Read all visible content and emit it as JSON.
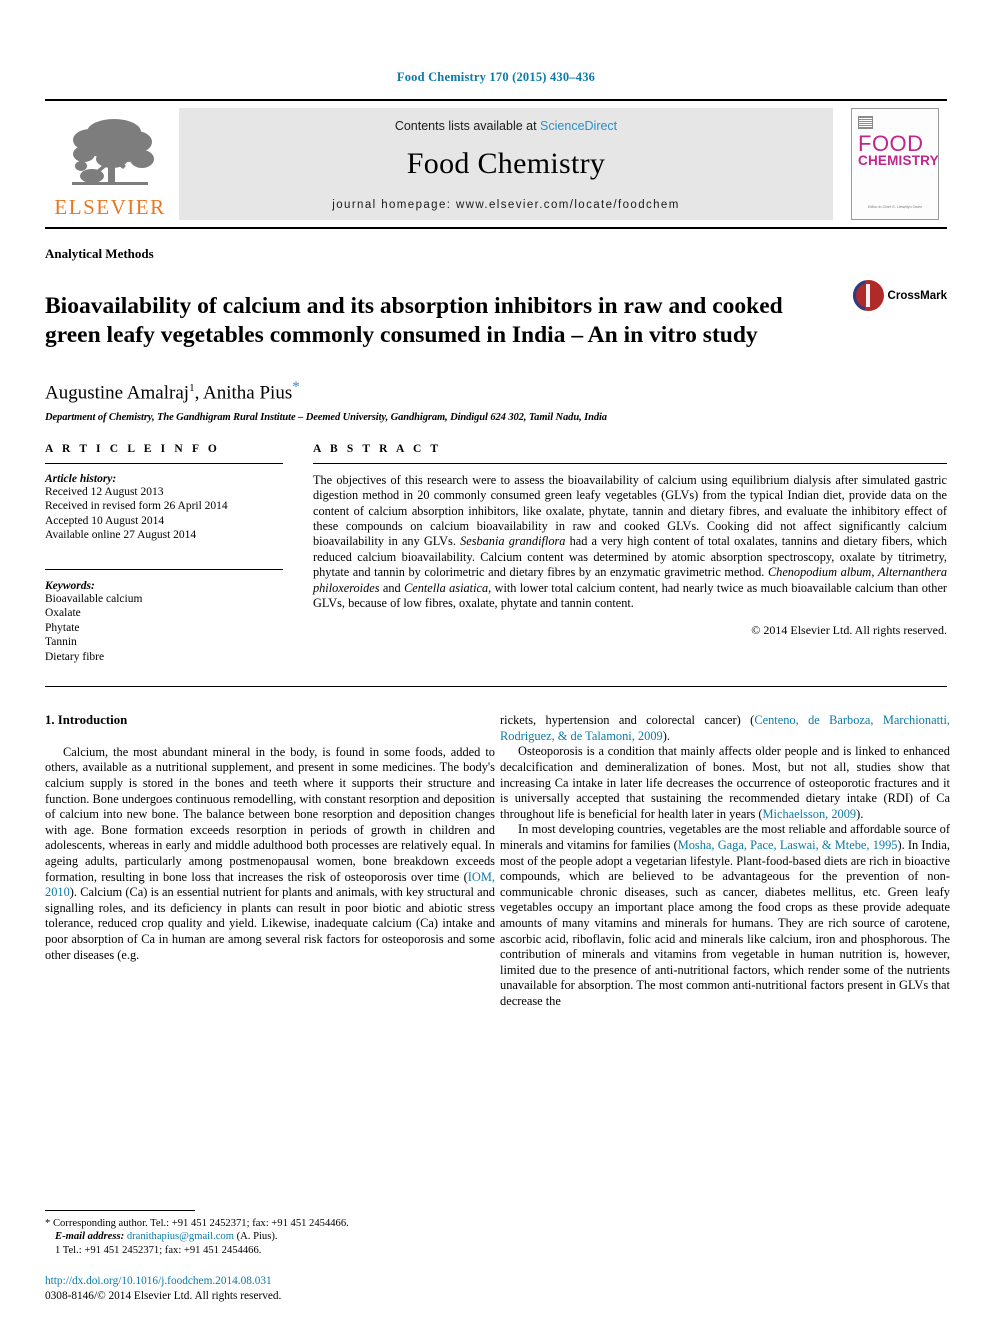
{
  "running_head": "Food Chemistry 170 (2015) 430–436",
  "masthead": {
    "publisher_name": "ELSEVIER",
    "contents_prefix": "Contents lists available at ",
    "contents_link": "ScienceDirect",
    "journal_name": "Food Chemistry",
    "homepage": "journal homepage: www.elsevier.com/locate/foodchem",
    "cover": {
      "line1": "FOOD",
      "line2": "CHEMISTRY",
      "footer": "Editor-in-Chief\nG. Llewellyn Owen"
    }
  },
  "article": {
    "section_kind": "Analytical Methods",
    "title": "Bioavailability of calcium and its absorption inhibitors in raw and cooked green leafy vegetables commonly consumed in India – An in vitro study",
    "crossmark_label": "CrossMark",
    "authors_1": "Augustine Amalraj",
    "authors_1_sup": "1",
    "authors_2": "Anitha Pius",
    "authors_2_sup": "*",
    "affiliation": "Department of Chemistry, The Gandhigram Rural Institute – Deemed University, Gandhigram, Dindigul 624 302, Tamil Nadu, India"
  },
  "article_info": {
    "heading": "A R T I C L E    I N F O",
    "history_label": "Article history:",
    "history": [
      "Received 12 August 2013",
      "Received in revised form 26 April 2014",
      "Accepted 10 August 2014",
      "Available online 27 August 2014"
    ],
    "keywords_label": "Keywords:",
    "keywords": [
      "Bioavailable calcium",
      "Oxalate",
      "Phytate",
      "Tannin",
      "Dietary fibre"
    ]
  },
  "abstract": {
    "heading": "A B S T R A C T",
    "p1_a": "The objectives of this research were to assess the bioavailability of calcium using equilibrium dialysis after simulated gastric digestion method in 20 commonly consumed green leafy vegetables (GLVs) from the typical Indian diet, provide data on the content of calcium absorption inhibitors, like oxalate, phytate, tannin and dietary fibres, and evaluate the inhibitory effect of these compounds on calcium bioavailability in raw and cooked GLVs. Cooking did not affect significantly calcium bioavailability in any GLVs. ",
    "sp1": "Sesbania grandiflora",
    "p1_b": " had a very high content of total oxalates, tannins and dietary fibers, which reduced calcium bioavailability. Calcium content was determined by atomic absorption spectroscopy, oxalate by titrimetry, phytate and tannin by colorimetric and dietary fibres by an enzymatic gravimetric method. ",
    "sp2": "Chenopodium album",
    "p1_c": ", ",
    "sp3": "Alternanthera philoxeroides",
    "p1_d": " and ",
    "sp4": "Centella asiatica",
    "p1_e": ", with lower total calcium content, had nearly twice as much bioavailable calcium than other GLVs, because of low fibres, oxalate, phytate and tannin content.",
    "copyright": "© 2014 Elsevier Ltd. All rights reserved."
  },
  "body": {
    "intro_heading": "1. Introduction",
    "left": {
      "p1_a": "Calcium, the most abundant mineral in the body, is found in some foods, added to others, available as a nutritional supplement, and present in some medicines. The body's calcium supply is stored in the bones and teeth where it supports their structure and function. Bone undergoes continuous remodelling, with constant resorption and deposition of calcium into new bone. The balance between bone resorption and deposition changes with age. Bone formation exceeds resorption in periods of growth in children and adolescents, whereas in early and middle adulthood both processes are relatively equal. In ageing adults, particularly among postmenopausal women, bone breakdown exceeds formation, resulting in bone loss that increases the risk of osteoporosis over time (",
      "cite1": "IOM, 2010",
      "p1_b": "). Calcium (Ca) is an essential nutrient for plants and animals, with key structural and signalling roles, and its deficiency in plants can result in poor biotic and abiotic stress tolerance, reduced crop quality and yield. Likewise, inadequate calcium (Ca) intake and poor absorption of Ca in human are among several risk factors for osteoporosis and some other diseases (e.g."
    },
    "right": {
      "p1_a": "rickets, hypertension and colorectal cancer) (",
      "cite1": "Centeno, de Barboza, Marchionatti, Rodriguez, & de Talamoni, 2009",
      "p1_b": ").",
      "p2_a": "Osteoporosis is a condition that mainly affects older people and is linked to enhanced decalcification and demineralization of bones. Most, but not all, studies show that increasing Ca intake in later life decreases the occurrence of osteoporotic fractures and it is universally accepted that sustaining the recommended dietary intake (RDI) of Ca throughout life is beneficial for health later in years (",
      "cite2": "Michaelsson, 2009",
      "p2_b": ").",
      "p3_a": "In most developing countries, vegetables are the most reliable and affordable source of minerals and vitamins for families (",
      "cite3": "Mosha, Gaga, Pace, Laswai, & Mtebe, 1995",
      "p3_b": "). In India, most of the people adopt a vegetarian lifestyle. Plant-food-based diets are rich in bioactive compounds, which are believed to be advantageous for the prevention of non-communicable chronic diseases, such as cancer, diabetes mellitus, etc. Green leafy vegetables occupy an important place among the food crops as these provide adequate amounts of many vitamins and minerals for humans. They are rich source of carotene, ascorbic acid, riboflavin, folic acid and minerals like calcium, iron and phosphorous. The contribution of minerals and vitamins from vegetable in human nutrition is, however, limited due to the presence of anti-nutritional factors, which render some of the nutrients unavailable for absorption. The most common anti-nutritional factors present in GLVs that decrease the"
    }
  },
  "footnotes": {
    "corresponding": "* Corresponding author. Tel.: +91 451 2452371; fax: +91 451 2454466.",
    "email_label": "E-mail address:",
    "email": "dranithapius@gmail.com",
    "email_suffix": " (A. Pius).",
    "tel_note": "1 Tel.: +91 451 2452371; fax: +91 451 2454466."
  },
  "doi_block": {
    "doi": "http://dx.doi.org/10.1016/j.foodchem.2014.08.031",
    "issn_line": "0308-8146/© 2014 Elsevier Ltd. All rights reserved."
  },
  "colors": {
    "link_blue": "#0b7aa8",
    "sciencedirect_blue": "#2a8fc4",
    "elsevier_orange": "#e87722",
    "cover_magenta": "#c0278e"
  }
}
